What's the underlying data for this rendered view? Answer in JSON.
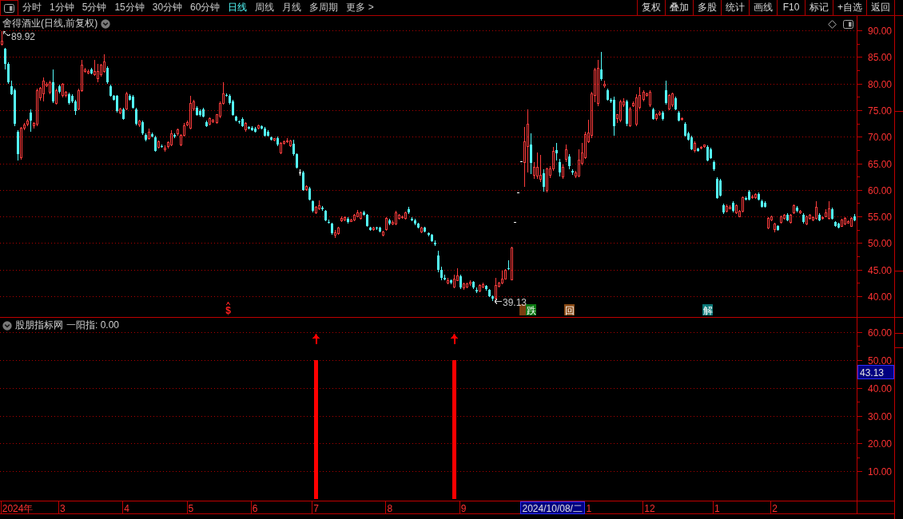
{
  "toolbar": {
    "tabs": [
      {
        "label": "分时",
        "selected": false
      },
      {
        "label": "1分钟",
        "selected": false
      },
      {
        "label": "5分钟",
        "selected": false
      },
      {
        "label": "15分钟",
        "selected": false
      },
      {
        "label": "30分钟",
        "selected": false
      },
      {
        "label": "60分钟",
        "selected": false
      },
      {
        "label": "日线",
        "selected": true
      },
      {
        "label": "周线",
        "selected": false
      },
      {
        "label": "月线",
        "selected": false
      },
      {
        "label": "多周期",
        "selected": false
      },
      {
        "label": "更多 >",
        "selected": false
      }
    ],
    "buttons": [
      "复权",
      "叠加",
      "多股",
      "统计",
      "画线",
      "F10",
      "标记",
      "+自选",
      "返回"
    ]
  },
  "price_pane": {
    "title": "舍得酒业(日线,前复权)",
    "high_label": "89.92",
    "low_label": "39.13",
    "markers": [
      {
        "kind": "symbol",
        "text": "$"
      },
      {
        "kind": "tile",
        "color": "#7a3d0f"
      },
      {
        "kind": "tile",
        "text": "跌",
        "color": "#0b7a12"
      },
      {
        "kind": "tile",
        "text": "回",
        "color": "#8a4a14"
      },
      {
        "kind": "tile",
        "text": "解",
        "color": "#0a7878"
      }
    ]
  },
  "indicator_pane": {
    "name": "股朋指标网",
    "reading": "一阳指: 0.00"
  },
  "cursor": {
    "date": "2024/10/08/二",
    "value": "43.13"
  },
  "chart_data": [
    {
      "type": "candlestick",
      "ylim": [
        36.1,
        92.7
      ],
      "yticks": [
        {
          "value": 40,
          "label": "40.00"
        },
        {
          "value": 45,
          "label": "45.00"
        },
        {
          "value": 50,
          "label": "50.00"
        },
        {
          "value": 55,
          "label": "55.00"
        },
        {
          "value": 60,
          "label": "60.00"
        },
        {
          "value": 65,
          "label": "65.00"
        },
        {
          "value": 70,
          "label": "70.00"
        },
        {
          "value": 75,
          "label": "75.00"
        },
        {
          "value": 80,
          "label": "80.00"
        },
        {
          "value": 85,
          "label": "85.00"
        },
        {
          "value": 90,
          "label": "90.00"
        }
      ],
      "grid": true,
      "ohlc": [
        [
          87.4,
          89.92,
          87.2,
          87.9
        ],
        [
          86.5,
          86.7,
          82.6,
          83.7
        ],
        [
          83.7,
          84.0,
          80.0,
          80.2
        ],
        [
          79.5,
          80.5,
          77.8,
          78.0
        ],
        [
          78.7,
          79.0,
          72.0,
          72.4
        ],
        [
          70.9,
          71.3,
          65.6,
          66.7
        ],
        [
          66.0,
          71.8,
          65.7,
          71.6
        ],
        [
          71.6,
          72.6,
          71.2,
          72.2
        ],
        [
          72.3,
          73.4,
          72.0,
          73.0
        ],
        [
          74.5,
          75.1,
          71.0,
          73.1
        ],
        [
          72.0,
          72.8,
          71.6,
          72.5
        ],
        [
          72.4,
          79.0,
          72.0,
          78.7
        ],
        [
          77.3,
          79.4,
          76.8,
          79.1
        ],
        [
          78.0,
          81.2,
          76.6,
          80.5
        ],
        [
          79.6,
          80.3,
          79.3,
          79.8
        ],
        [
          78.4,
          80.5,
          78.0,
          80.2
        ],
        [
          80.3,
          82.6,
          76.3,
          76.6
        ],
        [
          76.3,
          79.0,
          76.0,
          78.7
        ],
        [
          79.5,
          79.8,
          78.2,
          78.4
        ],
        [
          77.7,
          80.1,
          77.4,
          79.8
        ],
        [
          77.7,
          78.6,
          77.4,
          78.4
        ],
        [
          78.0,
          78.3,
          76.1,
          76.3
        ],
        [
          77.7,
          78.0,
          76.4,
          76.6
        ],
        [
          76.6,
          76.9,
          74.1,
          74.8
        ],
        [
          75.2,
          79.0,
          75.0,
          78.7
        ],
        [
          78.7,
          84.4,
          78.4,
          83.4
        ],
        [
          82.3,
          83.0,
          82.0,
          82.6
        ],
        [
          82.0,
          82.6,
          81.8,
          82.3
        ],
        [
          82.6,
          82.9,
          81.7,
          81.9
        ],
        [
          81.6,
          84.4,
          81.4,
          82.3
        ],
        [
          80.9,
          83.7,
          80.2,
          82.3
        ],
        [
          81.6,
          83.7,
          81.3,
          83.4
        ],
        [
          82.3,
          85.5,
          82.0,
          84.1
        ],
        [
          83.0,
          83.3,
          80.0,
          80.2
        ],
        [
          79.5,
          79.8,
          77.5,
          77.7
        ],
        [
          77.7,
          77.9,
          76.8,
          77.0
        ],
        [
          77.7,
          77.9,
          74.5,
          74.8
        ],
        [
          74.5,
          75.5,
          74.2,
          75.2
        ],
        [
          75.2,
          75.5,
          73.2,
          73.4
        ],
        [
          75.2,
          78.4,
          75.0,
          78.0
        ],
        [
          77.7,
          78.0,
          76.8,
          77.0
        ],
        [
          77.5,
          77.8,
          75.3,
          75.5
        ],
        [
          75.2,
          75.4,
          72.2,
          72.4
        ],
        [
          72.2,
          73.2,
          71.9,
          72.9
        ],
        [
          72.7,
          73.0,
          70.4,
          70.6
        ],
        [
          70.4,
          70.6,
          69.2,
          69.5
        ],
        [
          69.7,
          71.5,
          69.4,
          70.9
        ],
        [
          70.5,
          70.8,
          69.9,
          70.1
        ],
        [
          69.9,
          70.2,
          67.2,
          67.4
        ],
        [
          68.0,
          69.3,
          67.8,
          69.0
        ],
        [
          68.3,
          68.6,
          67.9,
          68.1
        ],
        [
          67.5,
          68.4,
          67.2,
          67.9
        ],
        [
          68.1,
          69.1,
          67.8,
          68.9
        ],
        [
          68.5,
          71.2,
          68.2,
          70.6
        ],
        [
          70.4,
          70.7,
          69.8,
          70.0
        ],
        [
          70.5,
          71.6,
          70.2,
          71.3
        ],
        [
          68.5,
          70.5,
          68.2,
          70.2
        ],
        [
          70.2,
          72.6,
          70.0,
          72.0
        ],
        [
          72.2,
          73.1,
          72.0,
          72.7
        ],
        [
          71.6,
          77.7,
          71.4,
          76.3
        ],
        [
          75.2,
          77.0,
          74.9,
          76.6
        ],
        [
          75.5,
          75.8,
          73.9,
          74.1
        ],
        [
          74.8,
          75.2,
          73.8,
          74.1
        ],
        [
          75.2,
          75.5,
          73.6,
          73.8
        ],
        [
          72.7,
          73.0,
          71.8,
          72.0
        ],
        [
          72.4,
          73.6,
          72.1,
          73.4
        ],
        [
          72.8,
          73.3,
          72.6,
          73.1
        ],
        [
          72.7,
          74.3,
          72.5,
          74.1
        ],
        [
          73.8,
          76.6,
          73.5,
          76.3
        ],
        [
          76.3,
          80.2,
          76.0,
          78.0
        ],
        [
          77.9,
          78.1,
          77.5,
          77.7
        ],
        [
          77.7,
          78.0,
          76.1,
          76.3
        ],
        [
          76.6,
          76.9,
          73.9,
          74.1
        ],
        [
          73.8,
          74.0,
          72.9,
          73.1
        ],
        [
          72.9,
          73.1,
          72.5,
          72.7
        ],
        [
          73.4,
          73.6,
          71.8,
          72.0
        ],
        [
          71.3,
          72.7,
          71.0,
          72.5
        ],
        [
          71.8,
          72.0,
          71.4,
          71.6
        ],
        [
          71.7,
          72.0,
          71.1,
          71.3
        ],
        [
          71.6,
          71.9,
          70.8,
          71.0
        ],
        [
          71.6,
          72.3,
          71.4,
          72.0
        ],
        [
          72.0,
          72.2,
          71.4,
          71.6
        ],
        [
          71.6,
          71.9,
          70.0,
          70.2
        ],
        [
          70.9,
          71.2,
          70.0,
          70.2
        ],
        [
          69.9,
          70.1,
          69.3,
          69.5
        ],
        [
          69.3,
          69.8,
          69.1,
          69.6
        ],
        [
          69.7,
          70.0,
          68.3,
          68.5
        ],
        [
          67.0,
          69.0,
          66.8,
          68.8
        ],
        [
          68.7,
          69.3,
          68.5,
          69.0
        ],
        [
          69.0,
          69.8,
          68.8,
          69.2
        ],
        [
          68.3,
          69.4,
          68.1,
          69.2
        ],
        [
          68.7,
          69.5,
          66.5,
          66.7
        ],
        [
          66.7,
          66.9,
          64.0,
          64.2
        ],
        [
          63.2,
          63.9,
          62.6,
          63.2
        ],
        [
          63.2,
          63.5,
          59.8,
          60.0
        ],
        [
          60.0,
          60.9,
          59.8,
          60.6
        ],
        [
          60.3,
          60.6,
          58.0,
          58.2
        ],
        [
          57.8,
          58.0,
          55.8,
          56.0
        ],
        [
          55.7,
          56.9,
          55.4,
          56.7
        ],
        [
          56.4,
          58.0,
          56.2,
          57.1
        ],
        [
          56.7,
          57.0,
          56.1,
          56.3
        ],
        [
          56.0,
          56.2,
          54.1,
          54.3
        ],
        [
          54.0,
          54.4,
          53.7,
          53.9
        ],
        [
          53.6,
          53.8,
          51.6,
          51.8
        ],
        [
          51.5,
          52.4,
          51.0,
          52.0
        ],
        [
          51.8,
          53.0,
          51.6,
          52.8
        ],
        [
          54.2,
          55.0,
          54.0,
          54.6
        ],
        [
          54.3,
          55.0,
          54.1,
          54.8
        ],
        [
          54.6,
          54.9,
          53.7,
          53.9
        ],
        [
          54.1,
          54.5,
          53.9,
          54.3
        ],
        [
          54.3,
          55.5,
          54.1,
          55.3
        ],
        [
          55.0,
          56.2,
          54.8,
          55.7
        ],
        [
          54.6,
          55.9,
          54.4,
          55.7
        ],
        [
          55.7,
          56.0,
          55.1,
          55.3
        ],
        [
          55.3,
          55.5,
          53.0,
          53.2
        ],
        [
          52.9,
          53.1,
          52.3,
          52.5
        ],
        [
          52.5,
          53.1,
          52.3,
          52.9
        ],
        [
          52.9,
          53.1,
          52.5,
          52.7
        ],
        [
          52.9,
          53.1,
          52.0,
          52.1
        ],
        [
          51.5,
          52.3,
          51.2,
          52.1
        ],
        [
          52.5,
          54.8,
          52.3,
          54.6
        ],
        [
          54.3,
          54.5,
          53.4,
          53.6
        ],
        [
          53.6,
          54.2,
          53.4,
          53.9
        ],
        [
          53.6,
          56.0,
          53.4,
          55.7
        ],
        [
          54.6,
          55.5,
          54.4,
          55.3
        ],
        [
          54.8,
          55.2,
          54.6,
          55.0
        ],
        [
          54.6,
          55.9,
          54.4,
          55.7
        ],
        [
          56.4,
          56.8,
          55.5,
          55.7
        ],
        [
          54.6,
          54.8,
          54.1,
          54.3
        ],
        [
          54.3,
          54.5,
          53.4,
          53.6
        ],
        [
          53.6,
          53.8,
          52.7,
          52.9
        ],
        [
          52.1,
          53.1,
          51.9,
          52.9
        ],
        [
          52.9,
          53.1,
          52.0,
          52.1
        ],
        [
          51.8,
          52.0,
          51.3,
          51.5
        ],
        [
          51.5,
          51.7,
          50.2,
          50.4
        ],
        [
          50.1,
          50.5,
          49.5,
          49.7
        ],
        [
          47.7,
          48.5,
          44.5,
          45.0
        ],
        [
          45.0,
          45.5,
          43.0,
          43.5
        ],
        [
          43.5,
          44.0,
          43.0,
          43.2
        ],
        [
          42.5,
          43.5,
          42.2,
          43.0
        ],
        [
          43.0,
          43.2,
          42.3,
          42.5
        ],
        [
          41.8,
          44.0,
          41.5,
          43.3
        ],
        [
          43.0,
          45.3,
          42.8,
          43.8
        ],
        [
          43.8,
          44.0,
          41.4,
          41.6
        ],
        [
          41.6,
          42.5,
          41.2,
          42.3
        ],
        [
          41.8,
          42.6,
          41.5,
          42.4
        ],
        [
          42.3,
          43.0,
          42.0,
          42.7
        ],
        [
          42.7,
          42.8,
          41.4,
          41.6
        ],
        [
          41.2,
          41.6,
          40.6,
          40.9
        ],
        [
          41.0,
          42.3,
          40.8,
          42.1
        ],
        [
          41.8,
          42.5,
          41.5,
          42.2
        ],
        [
          41.9,
          42.1,
          41.0,
          41.3
        ],
        [
          41.2,
          41.3,
          39.8,
          40.0
        ],
        [
          40.0,
          40.2,
          39.13,
          39.5
        ],
        [
          39.6,
          43.5,
          39.3,
          42.1
        ],
        [
          41.9,
          42.7,
          41.7,
          42.5
        ],
        [
          42.5,
          44.8,
          42.3,
          43.3
        ],
        [
          43.3,
          45.1,
          43.1,
          44.9
        ],
        [
          45.3,
          46.8,
          45.0,
          45.1
        ],
        [
          43.1,
          49.3,
          43.0,
          49.1
        ],
        [
          53.9,
          53.9,
          53.9,
          53.9
        ],
        [
          59.5,
          59.5,
          59.5,
          59.5
        ],
        [
          65.4,
          65.4,
          65.4,
          65.4
        ],
        [
          65.2,
          71.9,
          60.5,
          69.0
        ],
        [
          68.1,
          75.2,
          63.2,
          72.3
        ],
        [
          68.6,
          70.7,
          63.0,
          65.1
        ],
        [
          62.8,
          65.3,
          62.0,
          64.3
        ],
        [
          62.6,
          67.0,
          62.0,
          64.2
        ],
        [
          62.0,
          66.6,
          61.5,
          62.8
        ],
        [
          63.1,
          63.8,
          59.6,
          60.5
        ],
        [
          59.9,
          64.2,
          59.5,
          63.9
        ],
        [
          62.8,
          64.5,
          62.2,
          64.0
        ],
        [
          64.0,
          68.1,
          63.5,
          67.3
        ],
        [
          67.5,
          68.8,
          65.6,
          66.9
        ],
        [
          65.2,
          65.8,
          62.5,
          63.2
        ],
        [
          62.4,
          64.8,
          62.0,
          64.3
        ],
        [
          65.7,
          68.6,
          65.3,
          67.5
        ],
        [
          66.3,
          66.8,
          63.8,
          64.5
        ],
        [
          63.5,
          63.8,
          62.8,
          63.2
        ],
        [
          62.6,
          63.6,
          62.2,
          63.2
        ],
        [
          62.6,
          67.7,
          62.3,
          65.6
        ],
        [
          65.0,
          68.8,
          64.6,
          67.0
        ],
        [
          66.1,
          70.9,
          65.8,
          70.4
        ],
        [
          69.1,
          73.2,
          68.8,
          70.7
        ],
        [
          70.2,
          78.5,
          69.8,
          78.0
        ],
        [
          77.7,
          83.0,
          76.5,
          82.6
        ],
        [
          76.3,
          84.5,
          75.8,
          82.9
        ],
        [
          82.6,
          85.9,
          80.5,
          80.9
        ],
        [
          79.5,
          80.6,
          79.2,
          79.8
        ],
        [
          78.7,
          79.0,
          76.8,
          77.0
        ],
        [
          76.9,
          77.2,
          76.3,
          76.6
        ],
        [
          77.0,
          77.5,
          70.2,
          72.0
        ],
        [
          73.4,
          74.3,
          72.6,
          74.1
        ],
        [
          73.1,
          77.0,
          72.8,
          76.6
        ],
        [
          75.9,
          77.2,
          75.6,
          76.6
        ],
        [
          76.6,
          77.0,
          72.0,
          72.4
        ],
        [
          72.0,
          75.6,
          71.8,
          75.2
        ],
        [
          75.8,
          76.6,
          75.6,
          76.3
        ],
        [
          72.4,
          78.0,
          72.0,
          77.3
        ],
        [
          75.5,
          79.4,
          75.2,
          77.7
        ],
        [
          77.0,
          78.8,
          76.7,
          78.4
        ],
        [
          77.8,
          78.3,
          77.6,
          78.0
        ],
        [
          75.9,
          78.7,
          75.6,
          78.4
        ],
        [
          75.2,
          75.5,
          73.2,
          73.4
        ],
        [
          73.4,
          74.4,
          73.1,
          74.1
        ],
        [
          74.2,
          74.9,
          74.0,
          74.5
        ],
        [
          74.5,
          74.8,
          73.1,
          73.4
        ],
        [
          78.7,
          80.5,
          76.0,
          76.3
        ],
        [
          75.2,
          78.0,
          75.0,
          77.7
        ],
        [
          75.9,
          78.3,
          75.6,
          78.0
        ],
        [
          77.3,
          77.6,
          75.0,
          75.2
        ],
        [
          74.5,
          74.8,
          72.9,
          73.1
        ],
        [
          73.2,
          73.7,
          73.0,
          73.4
        ],
        [
          72.4,
          72.7,
          70.0,
          70.2
        ],
        [
          70.6,
          70.9,
          69.3,
          69.5
        ],
        [
          69.9,
          70.2,
          67.5,
          67.7
        ],
        [
          67.4,
          69.1,
          67.1,
          68.8
        ],
        [
          67.8,
          68.0,
          67.2,
          67.4
        ],
        [
          67.8,
          68.3,
          67.6,
          68.0
        ],
        [
          68.1,
          68.6,
          67.9,
          68.4
        ],
        [
          68.1,
          68.4,
          65.4,
          65.6
        ],
        [
          67.7,
          68.0,
          65.8,
          66.0
        ],
        [
          65.3,
          65.6,
          63.6,
          63.8
        ],
        [
          62.1,
          62.4,
          58.3,
          58.5
        ],
        [
          61.7,
          62.0,
          58.7,
          58.9
        ],
        [
          57.1,
          57.4,
          55.5,
          55.7
        ],
        [
          56.0,
          57.2,
          55.8,
          56.9
        ],
        [
          56.5,
          57.1,
          56.3,
          56.7
        ],
        [
          57.5,
          57.8,
          55.8,
          56.0
        ],
        [
          55.7,
          57.3,
          55.5,
          57.1
        ],
        [
          55.0,
          56.2,
          54.8,
          56.0
        ],
        [
          56.0,
          58.8,
          55.8,
          58.5
        ],
        [
          58.5,
          58.8,
          58.0,
          58.2
        ],
        [
          59.6,
          60.0,
          58.0,
          58.2
        ],
        [
          58.5,
          59.0,
          58.3,
          58.7
        ],
        [
          58.5,
          59.4,
          58.3,
          59.2
        ],
        [
          59.2,
          59.5,
          58.0,
          58.2
        ],
        [
          57.8,
          58.1,
          56.6,
          56.8
        ],
        [
          57.6,
          57.9,
          56.6,
          56.8
        ],
        [
          52.9,
          54.8,
          52.6,
          54.6
        ],
        [
          54.3,
          55.2,
          54.1,
          55.0
        ],
        [
          52.5,
          53.8,
          52.0,
          53.6
        ],
        [
          53.2,
          53.4,
          52.3,
          52.5
        ],
        [
          53.9,
          55.1,
          53.7,
          54.9
        ],
        [
          54.6,
          55.5,
          54.4,
          55.3
        ],
        [
          55.3,
          55.6,
          54.1,
          54.3
        ],
        [
          53.9,
          55.5,
          53.7,
          55.3
        ],
        [
          55.7,
          57.3,
          55.5,
          57.1
        ],
        [
          56.7,
          57.0,
          55.8,
          56.0
        ],
        [
          55.7,
          56.2,
          55.5,
          56.0
        ],
        [
          55.3,
          55.6,
          53.7,
          53.9
        ],
        [
          53.6,
          55.2,
          53.4,
          55.0
        ],
        [
          54.6,
          55.5,
          54.4,
          55.3
        ],
        [
          54.3,
          55.0,
          54.1,
          54.8
        ],
        [
          54.6,
          57.8,
          54.4,
          56.7
        ],
        [
          55.3,
          55.6,
          54.1,
          54.3
        ],
        [
          54.6,
          55.0,
          54.4,
          54.8
        ],
        [
          55.0,
          56.4,
          54.8,
          55.7
        ],
        [
          54.6,
          57.8,
          54.4,
          56.4
        ],
        [
          56.4,
          56.7,
          54.4,
          54.6
        ],
        [
          53.9,
          54.1,
          53.0,
          53.2
        ],
        [
          53.6,
          53.8,
          52.7,
          52.9
        ],
        [
          53.2,
          54.5,
          53.0,
          54.3
        ],
        [
          53.6,
          54.8,
          53.4,
          54.6
        ],
        [
          53.8,
          54.3,
          53.6,
          54.0
        ],
        [
          53.2,
          54.8,
          53.0,
          54.6
        ],
        [
          55.0,
          55.4,
          54.1,
          54.3
        ]
      ]
    },
    {
      "type": "bar",
      "ylim": [
        -0.6,
        65.2
      ],
      "yticks": [
        {
          "value": 10,
          "label": "10.00"
        },
        {
          "value": 20,
          "label": "20.00"
        },
        {
          "value": 30,
          "label": "30.00"
        },
        {
          "value": 40,
          "label": "40.00"
        },
        {
          "value": 50,
          "label": "50.00"
        },
        {
          "value": 60,
          "label": "60.00"
        }
      ],
      "grid": true,
      "color": "#ff0000",
      "categories": [
        null,
        null,
        null,
        null,
        null,
        "2024年",
        null,
        null,
        null,
        null,
        null,
        null,
        null,
        null,
        null,
        null,
        null,
        null,
        null,
        "3",
        null,
        null,
        null,
        null,
        null,
        null,
        null,
        null,
        null,
        null,
        null,
        null,
        null,
        null,
        null,
        null,
        null,
        null,
        null,
        "4",
        null,
        null,
        null,
        null,
        null,
        null,
        null,
        null,
        null,
        null,
        null,
        null,
        null,
        null,
        null,
        null,
        null,
        null,
        null,
        "5",
        null,
        null,
        null,
        null,
        null,
        null,
        null,
        null,
        null,
        null,
        null,
        null,
        null,
        null,
        null,
        null,
        null,
        null,
        null,
        "6",
        null,
        null,
        null,
        null,
        null,
        null,
        null,
        null,
        null,
        null,
        null,
        null,
        null,
        null,
        null,
        null,
        null,
        null,
        "7",
        null,
        null,
        null,
        null,
        null,
        null,
        null,
        null,
        null,
        null,
        null,
        null,
        null,
        null,
        null,
        null,
        null,
        null,
        null,
        null,
        null,
        null,
        "8",
        null,
        null,
        null,
        null,
        null,
        null,
        null,
        null,
        null,
        null,
        null,
        null,
        null,
        null,
        null,
        null,
        null,
        null,
        null,
        null,
        null,
        null,
        "9",
        null,
        null,
        null,
        null,
        null,
        null,
        null,
        null,
        null,
        null,
        null,
        null,
        null,
        null,
        null,
        null,
        null,
        null,
        null,
        null,
        null,
        null,
        null,
        null,
        null,
        null,
        null,
        null,
        null,
        null,
        null,
        null,
        null,
        null,
        null,
        null,
        null,
        null,
        "1",
        null,
        null,
        null,
        null,
        null,
        null,
        null,
        null,
        null,
        null,
        null,
        null,
        null,
        null,
        null,
        null,
        null,
        null,
        "12",
        null,
        null,
        null,
        null,
        null,
        null,
        null,
        null,
        null,
        null,
        null,
        null,
        null,
        null,
        null,
        null,
        null,
        null,
        null,
        null,
        "1",
        null,
        null,
        null,
        null,
        null,
        null,
        null,
        null,
        null,
        null,
        null,
        null,
        null,
        null,
        null,
        null,
        null,
        "2",
        null,
        null,
        null,
        null,
        null,
        null,
        null,
        null,
        null,
        null,
        null,
        null,
        null,
        null,
        null,
        null,
        null,
        null,
        null,
        null,
        null,
        null,
        null,
        null,
        null
      ],
      "values": [
        0,
        0,
        0,
        0,
        0,
        0,
        0,
        0,
        0,
        0,
        0,
        0,
        0,
        0,
        0,
        0,
        0,
        0,
        0,
        0,
        0,
        0,
        0,
        0,
        0,
        0,
        0,
        0,
        0,
        0,
        0,
        0,
        0,
        0,
        0,
        0,
        0,
        0,
        0,
        0,
        0,
        0,
        0,
        0,
        0,
        0,
        0,
        0,
        0,
        0,
        0,
        0,
        0,
        0,
        0,
        0,
        0,
        0,
        0,
        0,
        0,
        0,
        0,
        0,
        0,
        0,
        0,
        0,
        0,
        0,
        0,
        0,
        0,
        0,
        0,
        0,
        0,
        0,
        0,
        0,
        0,
        0,
        0,
        0,
        0,
        0,
        0,
        0,
        0,
        0,
        0,
        0,
        0,
        0,
        0,
        0,
        0,
        0,
        50,
        0,
        0,
        0,
        0,
        0,
        0,
        0,
        0,
        0,
        0,
        0,
        0,
        0,
        0,
        0,
        0,
        0,
        0,
        0,
        0,
        0,
        0,
        0,
        0,
        0,
        0,
        0,
        0,
        0,
        0,
        0,
        0,
        0,
        0,
        0,
        0,
        0,
        0,
        0,
        0,
        0,
        0,
        50,
        0,
        0,
        0,
        0,
        0,
        0,
        0,
        0,
        0,
        0,
        0,
        0,
        0,
        0,
        0,
        0,
        0,
        0,
        0,
        0,
        0,
        0,
        0,
        0,
        0,
        0,
        0,
        0,
        0,
        0,
        0,
        0,
        0,
        0,
        0,
        0,
        0,
        0,
        0,
        0,
        0,
        0,
        0,
        0,
        0,
        0,
        0,
        0,
        0,
        0,
        0,
        0,
        0,
        0,
        0,
        0,
        0,
        0,
        0,
        0,
        0,
        0,
        0,
        0,
        0,
        0,
        0,
        0,
        0,
        0,
        0,
        0,
        0,
        0,
        0,
        0,
        0,
        0,
        0,
        0,
        0,
        0,
        0,
        0,
        0,
        0,
        0,
        0,
        0,
        0,
        0,
        0,
        0,
        0,
        0,
        0,
        0,
        0,
        0,
        0,
        0,
        0,
        0,
        0,
        0,
        0,
        0,
        0,
        0,
        0,
        0,
        0,
        0,
        0,
        0,
        0,
        0,
        0,
        0,
        0,
        0,
        0,
        0,
        0,
        0
      ]
    }
  ]
}
